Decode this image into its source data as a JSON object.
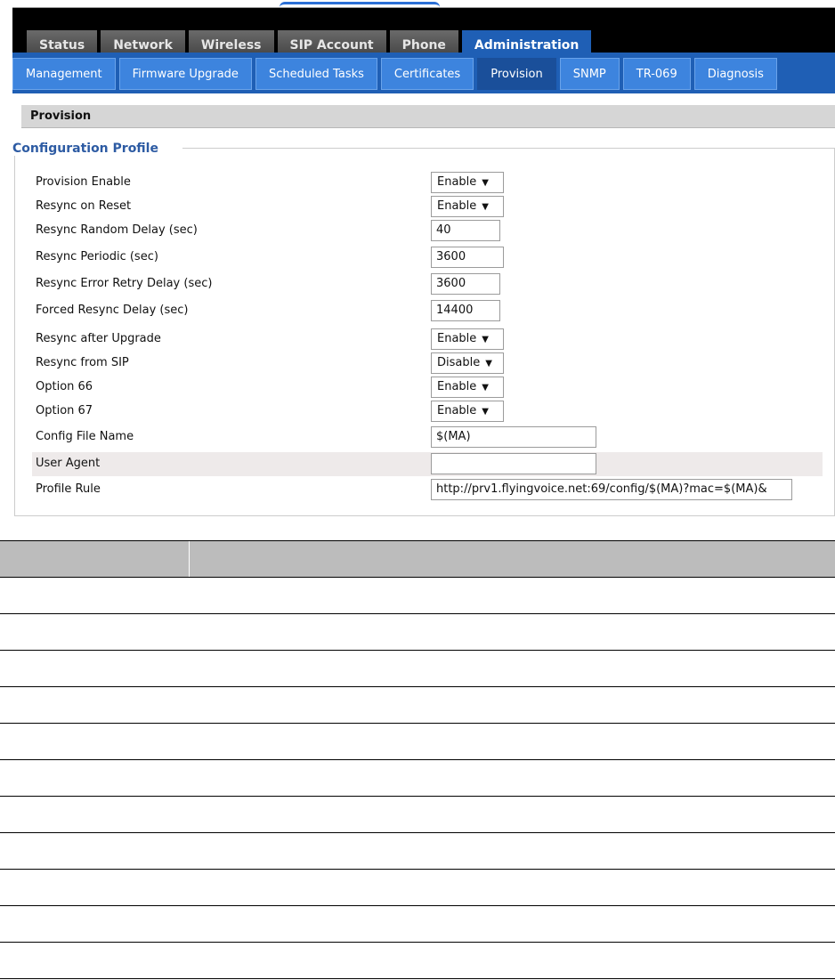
{
  "main_tabs": [
    {
      "label": "Status",
      "active": false
    },
    {
      "label": "Network",
      "active": false
    },
    {
      "label": "Wireless",
      "active": false
    },
    {
      "label": "SIP Account",
      "active": false
    },
    {
      "label": "Phone",
      "active": false
    },
    {
      "label": "Administration",
      "active": true
    }
  ],
  "sub_tabs": [
    {
      "label": "Management",
      "active": false
    },
    {
      "label": "Firmware Upgrade",
      "active": false
    },
    {
      "label": "Scheduled Tasks",
      "active": false
    },
    {
      "label": "Certificates",
      "active": false
    },
    {
      "label": "Provision",
      "active": true
    },
    {
      "label": "SNMP",
      "active": false
    },
    {
      "label": "TR-069",
      "active": false
    },
    {
      "label": "Diagnosis",
      "active": false
    }
  ],
  "section_title": "Provision",
  "fieldset_legend": "Configuration Profile",
  "form": {
    "provision_enable": {
      "label": "Provision Enable",
      "value": "Enable"
    },
    "resync_on_reset": {
      "label": "Resync on Reset",
      "value": "Enable"
    },
    "resync_random_delay": {
      "label": "Resync Random Delay (sec)",
      "value": "40"
    },
    "resync_periodic": {
      "label": "Resync Periodic (sec)",
      "value": "3600"
    },
    "resync_error_retry_delay": {
      "label": "Resync Error Retry Delay (sec)",
      "value": "3600"
    },
    "forced_resync_delay": {
      "label": "Forced Resync Delay (sec)",
      "value": "14400"
    },
    "resync_after_upgrade": {
      "label": "Resync after Upgrade",
      "value": "Enable"
    },
    "resync_from_sip": {
      "label": "Resync from SIP",
      "value": "Disable"
    },
    "option_66": {
      "label": "Option 66",
      "value": "Enable"
    },
    "option_67": {
      "label": "Option 67",
      "value": "Enable"
    },
    "config_file_name": {
      "label": "Config File Name",
      "value": "$(MA)"
    },
    "user_agent": {
      "label": "User Agent",
      "value": ""
    },
    "profile_rule": {
      "label": "Profile Rule",
      "value": "http://prv1.flyingvoice.net:69/config/$(MA)?mac=$(MA)&"
    }
  },
  "icons": {
    "dropdown": "triangle-down-icon"
  },
  "colors": {
    "accent_blue": "#1f5fb5",
    "tab_blue": "#3d84de",
    "legend_blue": "#2d5ba3"
  }
}
